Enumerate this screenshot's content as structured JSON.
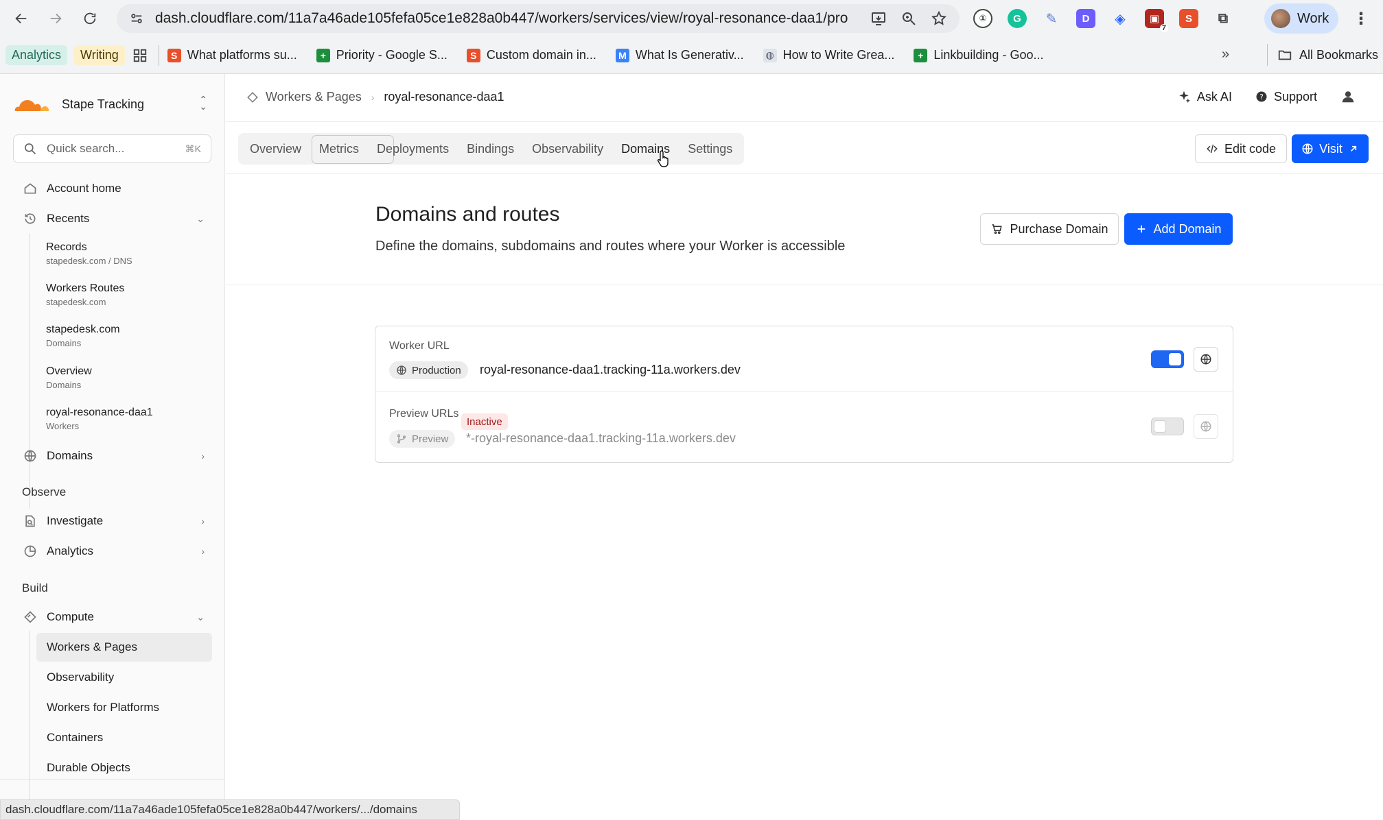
{
  "browser": {
    "url": "dash.cloudflare.com/11a7a46ade105fefa05ce1e828a0b447/workers/services/view/royal-resonance-daa1/pro...",
    "profile_name": "Work",
    "bookmarks": {
      "tag_analytics": "Analytics",
      "tag_writing": "Writing",
      "items": [
        {
          "label": "What platforms su...",
          "icon": "stape-icon",
          "color": "#e8502b"
        },
        {
          "label": "Priority - Google S...",
          "icon": "sheets-icon",
          "color": "#1e8e3e"
        },
        {
          "label": "Custom domain in...",
          "icon": "stape-icon",
          "color": "#e8502b"
        },
        {
          "label": "What Is Generativ...",
          "icon": "medium-icon",
          "color": "#3b82f6"
        },
        {
          "label": "How to Write Grea...",
          "icon": "globe-icon",
          "color": "#8a8a8a"
        },
        {
          "label": "Linkbuilding - Goo...",
          "icon": "sheets-icon",
          "color": "#1e8e3e"
        }
      ],
      "all_bookmarks": "All Bookmarks"
    },
    "status_url": "dash.cloudflare.com/11a7a46ade105fefa05ce1e828a0b447/workers/.../domains",
    "extension_badge": "7"
  },
  "sidebar": {
    "account_name": "Stape Tracking",
    "search_placeholder": "Quick search...",
    "search_shortcut": "⌘K",
    "account_home": "Account home",
    "recents_label": "Recents",
    "recents": [
      {
        "title": "Records",
        "sub": "stapedesk.com  /  DNS"
      },
      {
        "title": "Workers Routes",
        "sub": "stapedesk.com"
      },
      {
        "title": "stapedesk.com",
        "sub": "Domains"
      },
      {
        "title": "Overview",
        "sub": "Domains"
      },
      {
        "title": "royal-resonance-daa1",
        "sub": "Workers"
      }
    ],
    "domains": "Domains",
    "observe_heading": "Observe",
    "investigate": "Investigate",
    "analytics": "Analytics",
    "build_heading": "Build",
    "compute": "Compute",
    "compute_items": [
      "Workers & Pages",
      "Observability",
      "Workers for Platforms",
      "Containers",
      "Durable Objects"
    ]
  },
  "topbar": {
    "crumb_parent": "Workers & Pages",
    "crumb_current": "royal-resonance-daa1",
    "ask_ai": "Ask AI",
    "support": "Support"
  },
  "tabs": [
    "Overview",
    "Metrics",
    "Deployments",
    "Bindings",
    "Observability",
    "Domains",
    "Settings"
  ],
  "actions": {
    "edit_code": "Edit code",
    "visit": "Visit"
  },
  "page": {
    "title": "Domains and routes",
    "description": "Define the domains, subdomains and routes where your Worker is accessible",
    "purchase_domain": "Purchase Domain",
    "add_domain": "Add Domain"
  },
  "worker_url": {
    "label": "Worker URL",
    "env": "Production",
    "url": "royal-resonance-daa1.tracking-11a.workers.dev",
    "enabled": true
  },
  "preview_urls": {
    "label": "Preview URLs",
    "status": "Inactive",
    "env": "Preview",
    "url": "*-royal-resonance-daa1.tracking-11a.workers.dev",
    "enabled": false
  },
  "colors": {
    "accent": "#0b5cff",
    "inactive_bg": "#fde7e7",
    "inactive_text": "#a01818",
    "cloudflare_orange": "#f38020"
  }
}
